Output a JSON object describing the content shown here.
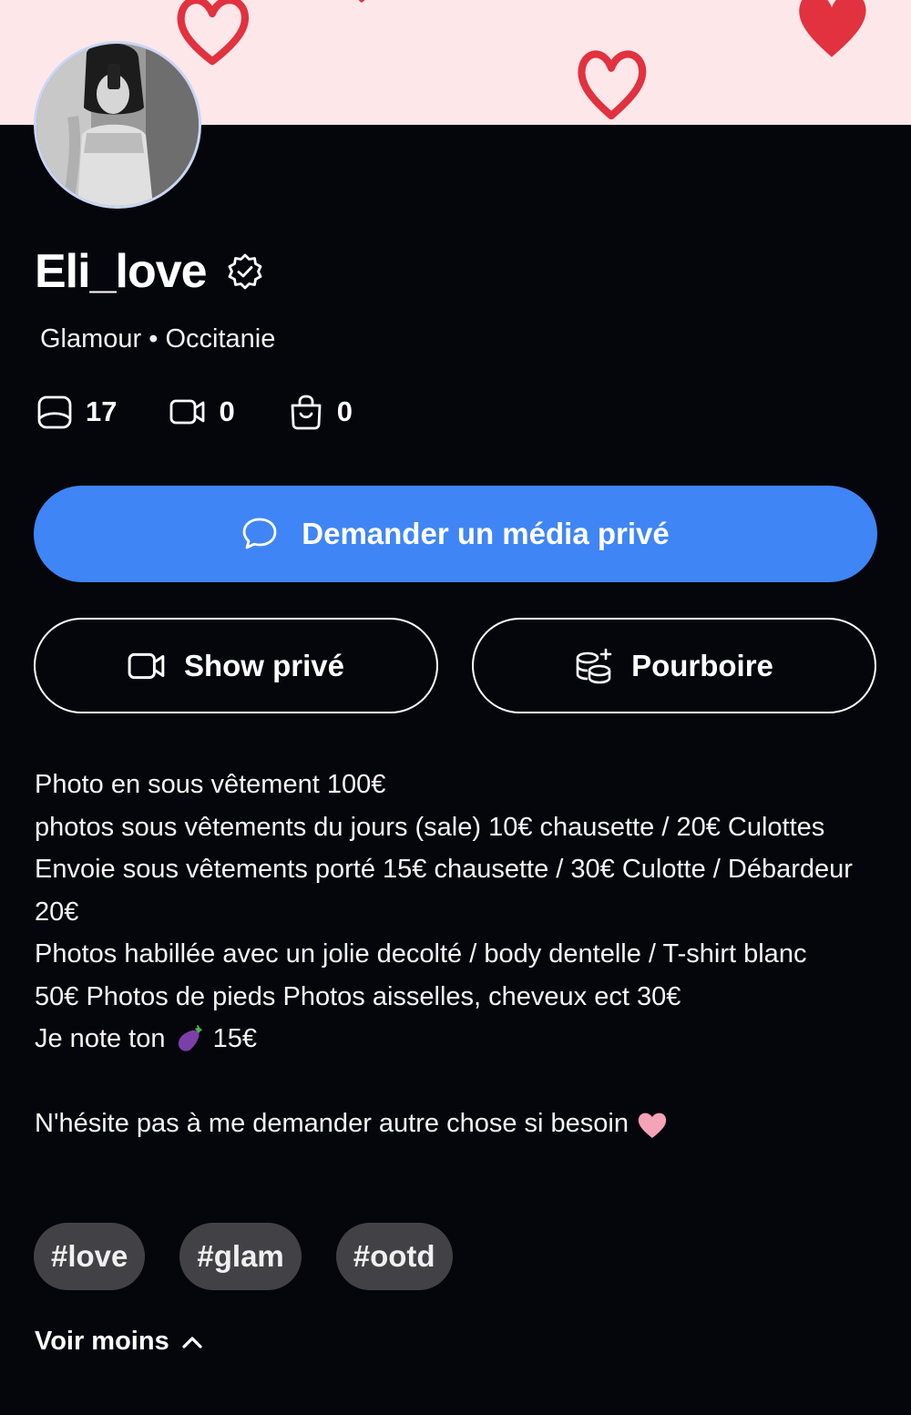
{
  "profile": {
    "username": "Eli_love",
    "subtitle": "Glamour • Occitanie",
    "stats": {
      "photos": "17",
      "videos": "0",
      "products": "0"
    }
  },
  "actions": {
    "request_media_label": "Demander un média privé",
    "private_show_label": "Show privé",
    "tip_label": "Pourboire"
  },
  "bio": {
    "line1": "Photo en sous vêtement 100€",
    "line2": "photos sous vêtements du jours (sale) 10€ chausette / 20€ Culottes",
    "line3": "Envoie sous vêtements porté 15€ chausette / 30€ Culotte / Débardeur 20€",
    "line4": "Photos habillée avec un jolie decolté / body dentelle / T-shirt blanc 50€ Photos de pieds Photos aisselles, cheveux ect 30€",
    "line5_before": "Je note ton",
    "line5_after": "15€",
    "closing": "N'hésite pas à me demander autre chose si besoin"
  },
  "tags": [
    "#love",
    "#glam",
    "#ootd"
  ],
  "toggle": {
    "label": "Voir moins"
  },
  "colors": {
    "background": "#05060b",
    "banner": "#fde7e9",
    "primary": "#3f85f6",
    "tag_bg": "#424246",
    "heart_red": "#e2313f"
  }
}
